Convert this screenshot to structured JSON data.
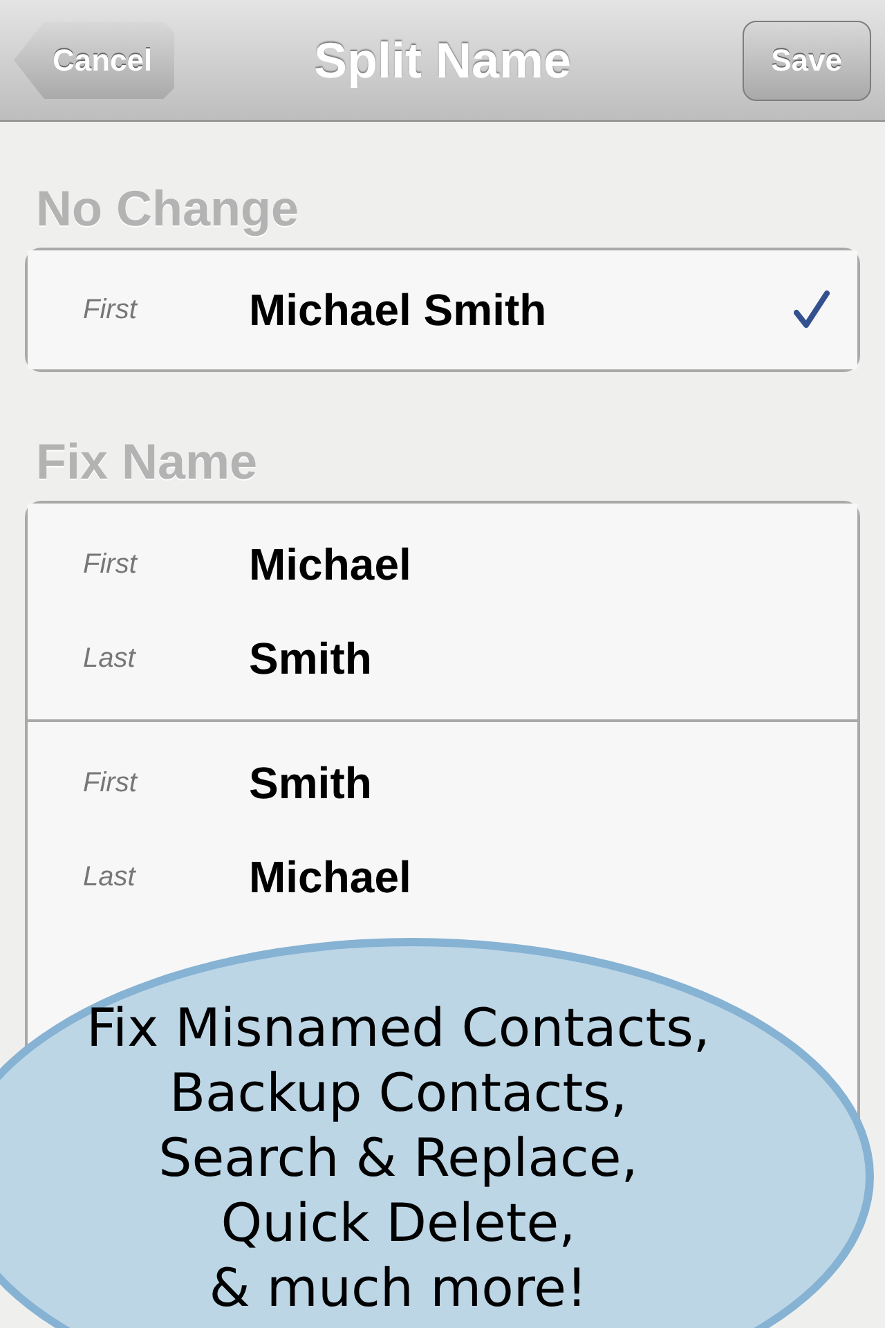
{
  "nav": {
    "back": "Cancel",
    "title": "Split Name",
    "action": "Save"
  },
  "sections": [
    {
      "title": "No Change",
      "options": [
        {
          "selected": true,
          "fields": [
            {
              "label": "First",
              "value": "Michael Smith"
            }
          ]
        }
      ]
    },
    {
      "title": "Fix Name",
      "options": [
        {
          "selected": false,
          "fields": [
            {
              "label": "First",
              "value": "Michael"
            },
            {
              "label": "Last",
              "value": "Smith"
            }
          ]
        },
        {
          "selected": false,
          "fields": [
            {
              "label": "First",
              "value": "Smith"
            },
            {
              "label": "Last",
              "value": "Michael"
            }
          ]
        }
      ]
    }
  ],
  "banner": {
    "lines": [
      "Fix Misnamed Contacts,",
      "Backup Contacts,",
      "Search & Replace,",
      "Quick Delete,",
      "& much more!"
    ]
  }
}
